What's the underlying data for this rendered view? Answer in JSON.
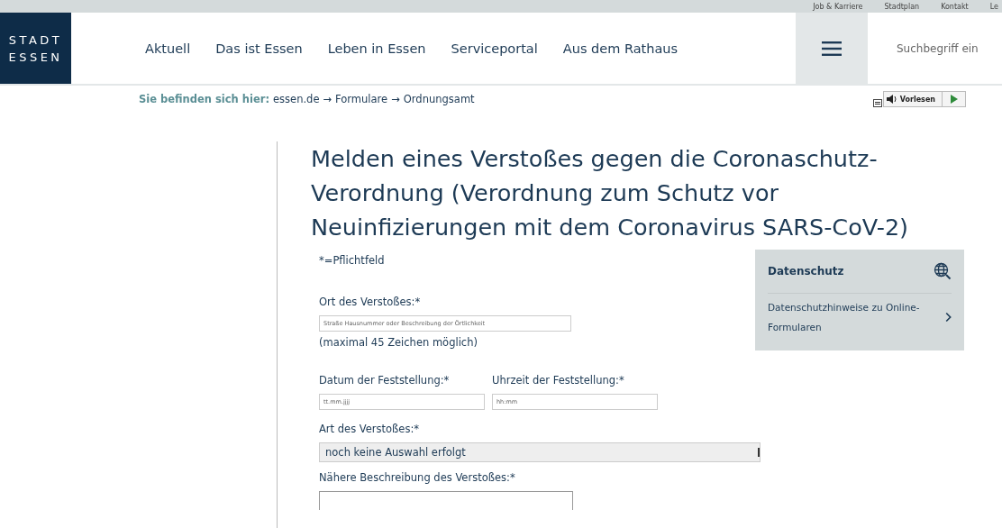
{
  "top_links": [
    "Job & Karriere",
    "Stadtplan",
    "Kontakt",
    "Le"
  ],
  "logo": [
    "STADT",
    "ESSEN"
  ],
  "nav": [
    "Aktuell",
    "Das ist Essen",
    "Leben in Essen",
    "Serviceportal",
    "Aus dem Rathaus"
  ],
  "search": {
    "placeholder": "Suchbegriff ein"
  },
  "breadcrumb": {
    "label": "Sie befinden sich hier:",
    "items": [
      "essen.de",
      "Formulare",
      "Ordnungsamt"
    ],
    "separator": "→"
  },
  "read_aloud": {
    "label": "Vorlesen"
  },
  "title": "Melden eines Verstoßes gegen die Coronaschutz-Verordnung (Verordnung zum Schutz vor Neuinfizierungen mit dem Coronavirus SARS-CoV-2)",
  "required_note": "*=Pflichtfeld",
  "form": [
    {
      "kind": "text",
      "label": "Ort des Verstoßes:*",
      "placeholder": "Straße Hausnummer oder Beschreibung der Örtlichkeit",
      "hint": "(maximal 45 Zeichen möglich)"
    },
    {
      "kind": "pair",
      "fields": [
        {
          "label": "Datum der Feststellung:*",
          "placeholder": "tt.mm.jjjj"
        },
        {
          "label": "Uhrzeit der Feststellung:*",
          "placeholder": "hh:mm"
        }
      ]
    },
    {
      "kind": "select",
      "label": "Art des Verstoßes:*",
      "value": "noch keine Auswahl erfolgt"
    },
    {
      "kind": "textarea",
      "label": "Nähere Beschreibung des Verstoßes:*"
    }
  ],
  "sidebar": {
    "title": "Datenschutz",
    "link": "Datenschutzhinweise zu Online-Formularen"
  }
}
